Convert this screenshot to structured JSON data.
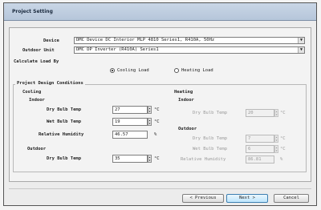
{
  "window": {
    "title": "Project Setting"
  },
  "project": {
    "device_label": "Device",
    "device_value": "DMC Device DC Interior MLP 4810 Series1, R410A, 50Hz",
    "outdoor_label": "Outdoor Unit",
    "outdoor_value": "DMC DP Inverter (R410A) Series1",
    "calc_label": "Calculate Load By",
    "calc_options": [
      {
        "label": "Cooling Load",
        "selected": true
      },
      {
        "label": "Heating Load",
        "selected": false
      }
    ]
  },
  "design": {
    "group_title": "Project Design Conditions",
    "cooling": {
      "title": "Cooling",
      "indoor_title": "Indoor",
      "dry_bulb_label": "Dry Bulb Temp",
      "dry_bulb_value": "27",
      "wet_bulb_label": "Wet Bulb Temp",
      "wet_bulb_value": "19",
      "rh_label": "Relative Humidity",
      "rh_value": "46.57",
      "temp_unit": "°C",
      "rh_unit": "%",
      "outdoor_title": "Outdoor",
      "out_dry_bulb_label": "Dry Bulb Temp",
      "out_dry_bulb_value": "35"
    },
    "heating": {
      "title": "Heating",
      "indoor_title": "Indoor",
      "dry_bulb_label": "Dry Bulb Temp",
      "dry_bulb_value": "20",
      "outdoor_title": "Outdoor",
      "out_dry_bulb_label": "Dry Bulb Temp",
      "out_dry_bulb_value": "7",
      "out_wet_bulb_label": "Wet Bulb Temp",
      "out_wet_bulb_value": "6",
      "rh_label": "Relative Humidity",
      "rh_value": "86.81",
      "temp_unit": "°C",
      "rh_unit": "%"
    }
  },
  "buttons": {
    "prev": "< Previous",
    "next": "Next >",
    "cancel": "Cancel"
  }
}
